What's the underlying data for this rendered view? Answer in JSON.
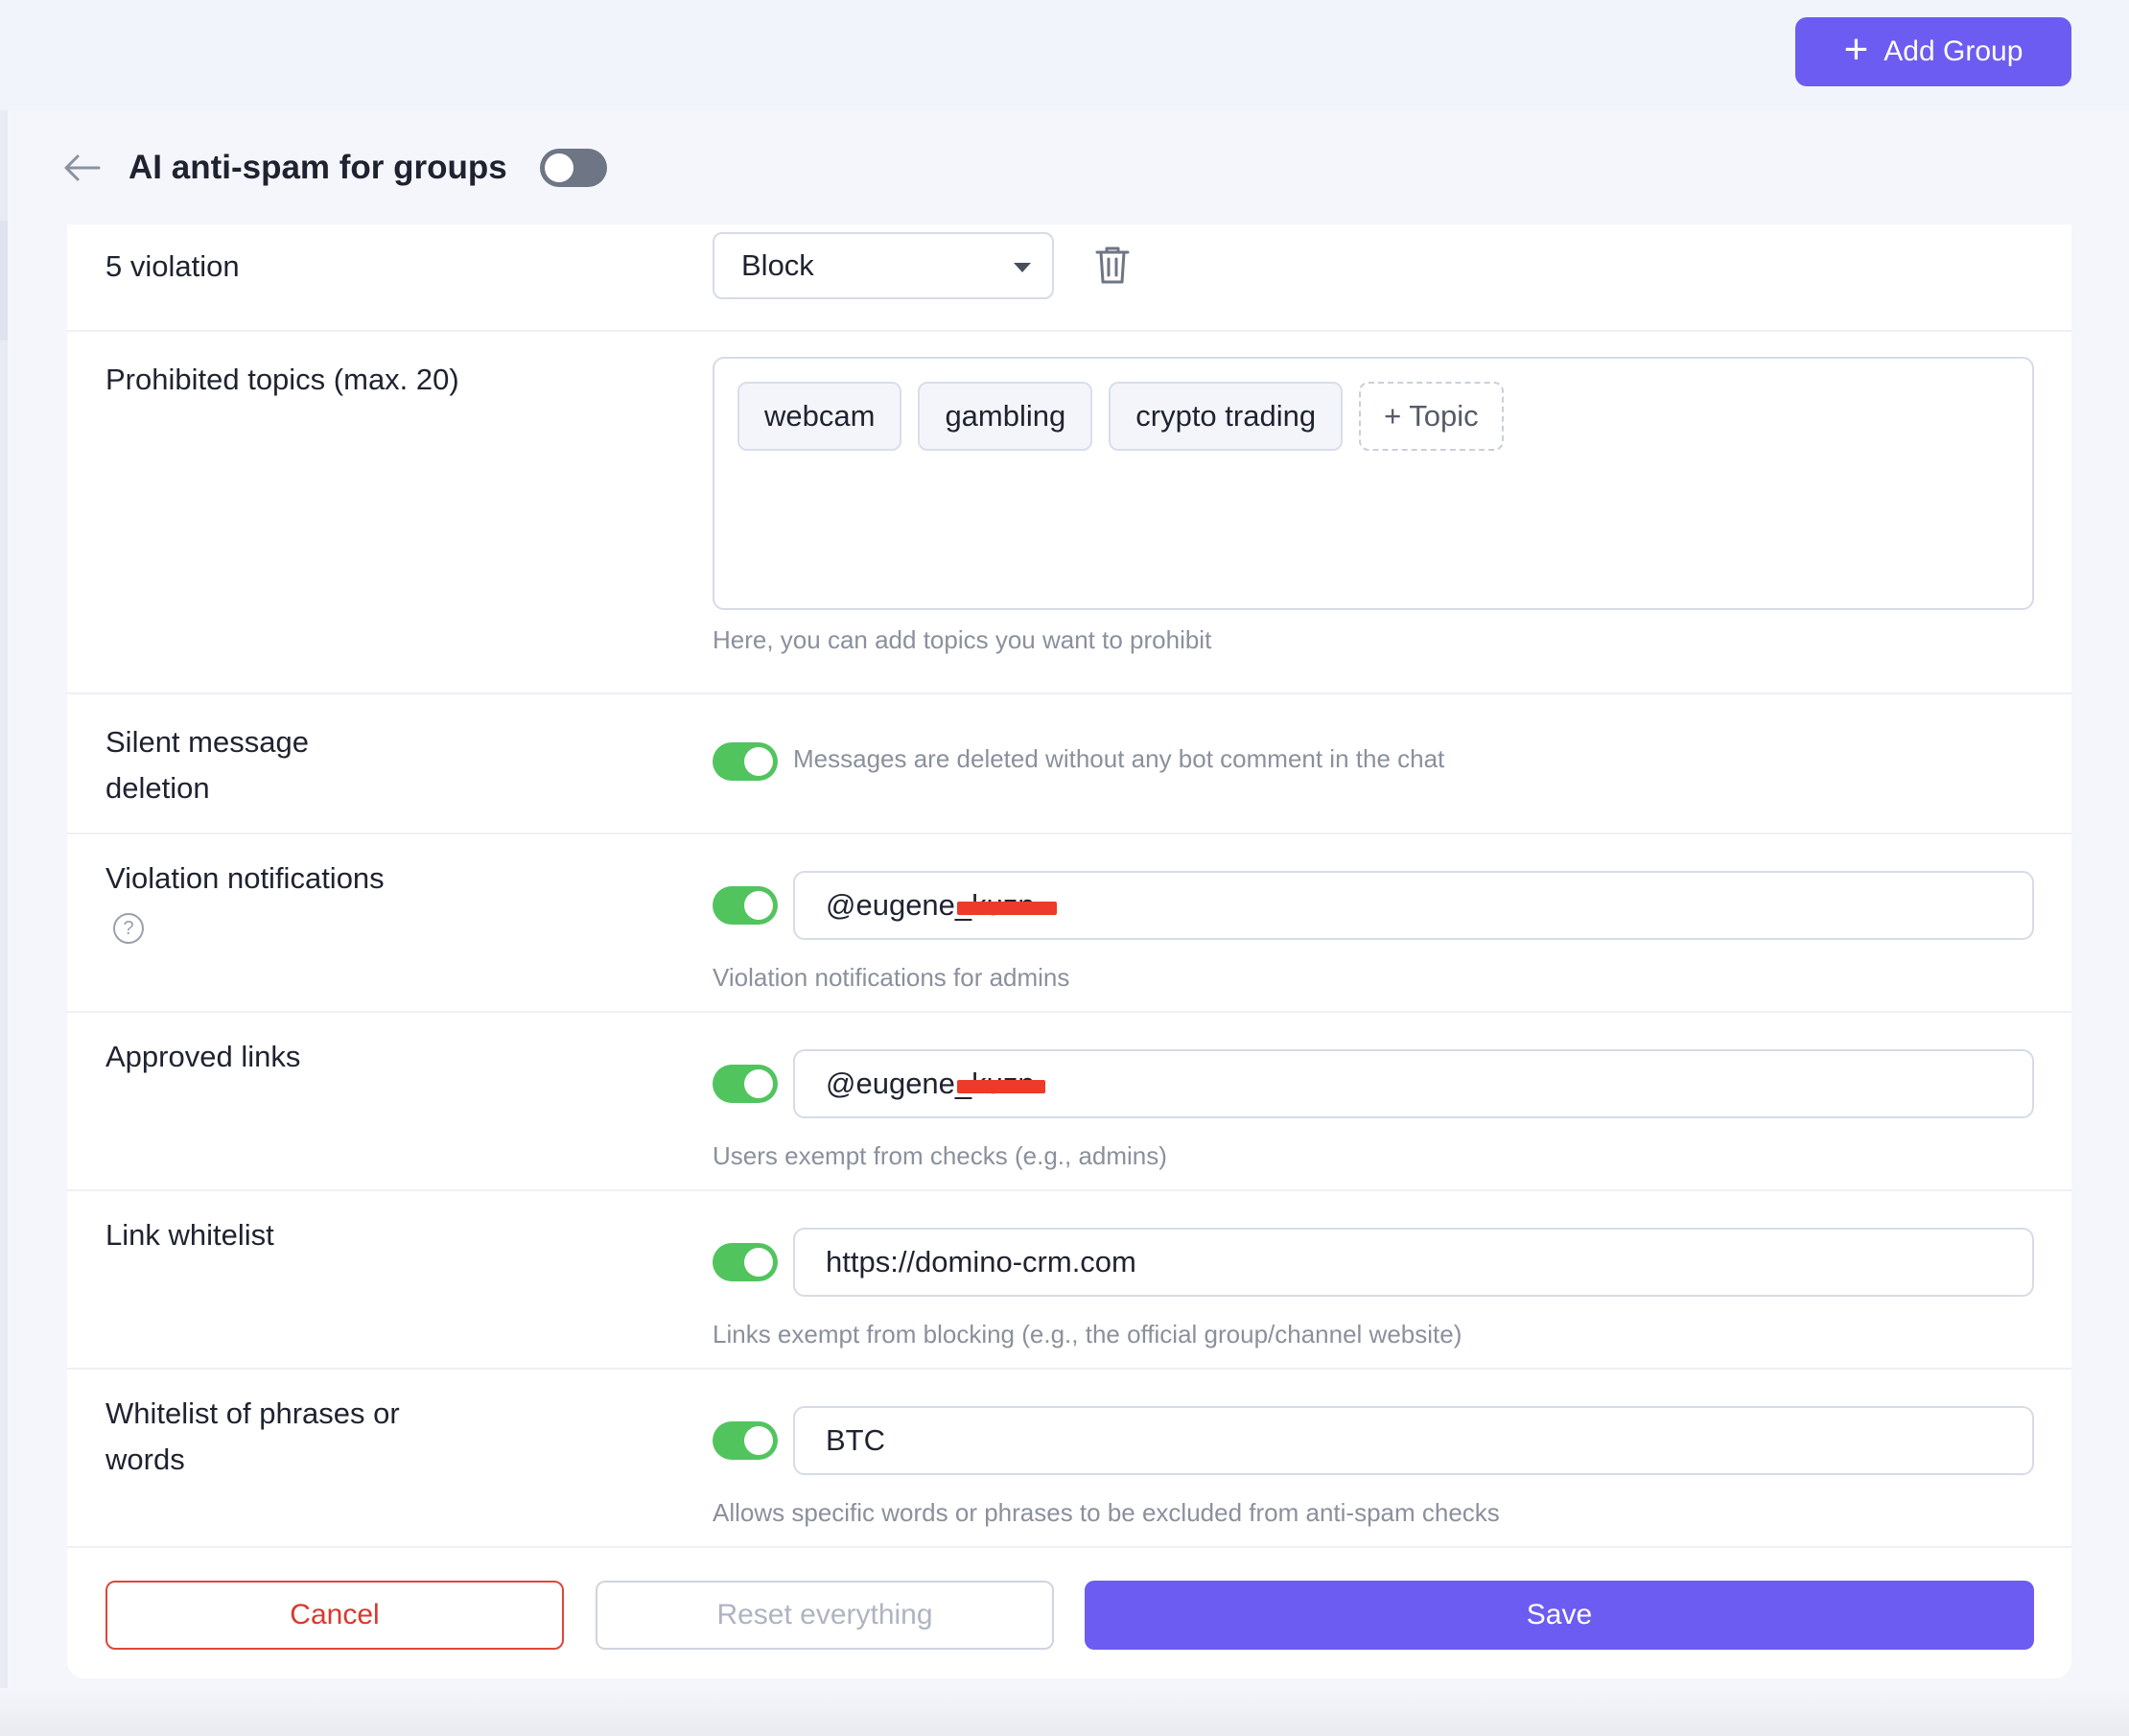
{
  "topbar": {
    "add_group_label": "Add Group"
  },
  "header": {
    "title": "AI anti-spam for groups",
    "enabled": false
  },
  "violation_row": {
    "label": "5 violation",
    "action_value": "Block"
  },
  "topics": {
    "label": "Prohibited topics (max. 20)",
    "items": [
      "webcam",
      "gambling",
      "crypto trading"
    ],
    "add_label": "+ Topic",
    "hint": "Here, you can add topics you want to prohibit"
  },
  "silent_deletion": {
    "label": "Silent message deletion",
    "enabled": true,
    "hint": "Messages are deleted without any bot comment in the chat"
  },
  "violation_notifications": {
    "label": "Violation notifications",
    "enabled": true,
    "value": "@eugene_kuzn",
    "hint": "Violation notifications for admins"
  },
  "approved_links": {
    "label": "Approved links",
    "enabled": true,
    "value": "@eugene_kuzn",
    "hint": "Users exempt from checks (e.g., admins)"
  },
  "link_whitelist": {
    "label": "Link whitelist",
    "enabled": true,
    "value": "https://domino-crm.com",
    "hint": "Links exempt from blocking (e.g., the official group/channel website)"
  },
  "phrase_whitelist": {
    "label": "Whitelist of phrases or words",
    "enabled": true,
    "value": "BTC",
    "hint": "Allows specific words or phrases to be excluded from anti-spam checks"
  },
  "footer": {
    "cancel_label": "Cancel",
    "reset_label": "Reset everything",
    "save_label": "Save"
  },
  "colors": {
    "accent": "#6c5cf2",
    "toggle_on": "#51c45e",
    "toggle_off": "#6e7584",
    "danger": "#d9382e",
    "redaction": "#ee3a2a"
  },
  "icons": [
    "plus-icon",
    "back-arrow-icon",
    "caret-down-icon",
    "trash-icon",
    "help-icon"
  ]
}
